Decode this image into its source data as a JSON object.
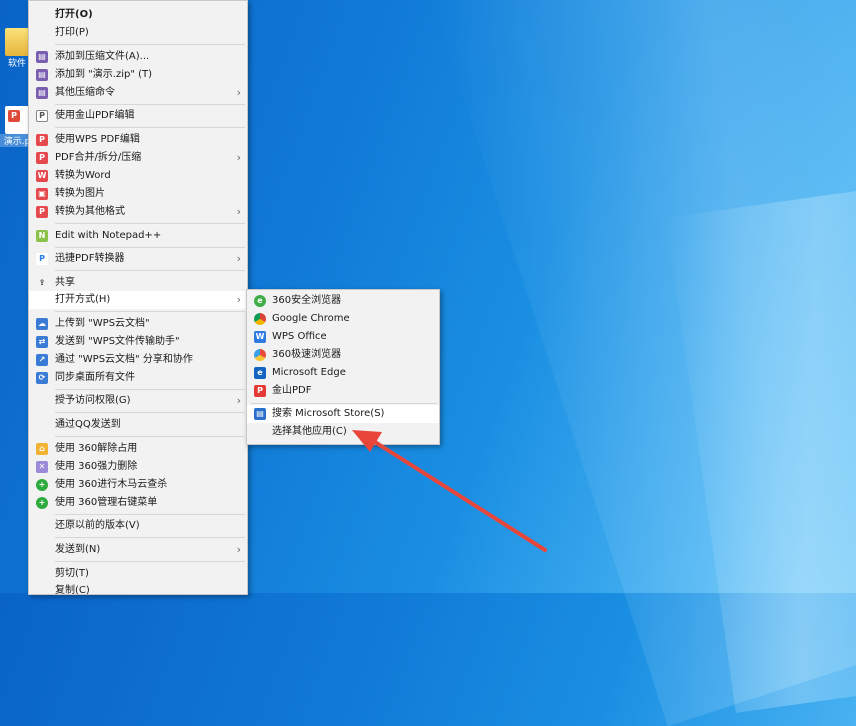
{
  "desktop": {
    "icons": [
      {
        "label": "软件"
      },
      {
        "label": "演示.p"
      }
    ]
  },
  "context_menu": {
    "items": [
      {
        "label": "打开(O)",
        "bold": true
      },
      {
        "label": "打印(P)"
      },
      {
        "label": "添加到压缩文件(A)..."
      },
      {
        "label": "添加到 \"演示.zip\" (T)"
      },
      {
        "label": "其他压缩命令"
      },
      {
        "label": "使用金山PDF编辑"
      },
      {
        "label": "使用WPS PDF编辑"
      },
      {
        "label": "PDF合并/拆分/压缩"
      },
      {
        "label": "转换为Word"
      },
      {
        "label": "转换为图片"
      },
      {
        "label": "转换为其他格式"
      },
      {
        "label": "Edit with Notepad++"
      },
      {
        "label": "迅捷PDF转换器"
      },
      {
        "label": "共享"
      },
      {
        "label": "打开方式(H)"
      },
      {
        "label": "上传到 \"WPS云文档\""
      },
      {
        "label": "发送到 \"WPS文件传输助手\""
      },
      {
        "label": "通过 \"WPS云文档\" 分享和协作"
      },
      {
        "label": "同步桌面所有文件"
      },
      {
        "label": "授予访问权限(G)"
      },
      {
        "label": "通过QQ发送到"
      },
      {
        "label": "使用 360解除占用"
      },
      {
        "label": "使用 360强力删除"
      },
      {
        "label": "使用 360进行木马云查杀"
      },
      {
        "label": "使用 360管理右键菜单"
      },
      {
        "label": "还原以前的版本(V)"
      },
      {
        "label": "发送到(N)"
      },
      {
        "label": "剪切(T)"
      },
      {
        "label": "复制(C)"
      }
    ]
  },
  "open_with_submenu": {
    "items": [
      {
        "label": "360安全浏览器"
      },
      {
        "label": "Google Chrome"
      },
      {
        "label": "WPS Office"
      },
      {
        "label": "360极速浏览器"
      },
      {
        "label": "Microsoft Edge"
      },
      {
        "label": "金山PDF"
      },
      {
        "label": "搜索 Microsoft Store(S)"
      },
      {
        "label": "选择其他应用(C)"
      }
    ]
  },
  "colors": {
    "annotation_arrow": "#e8463a",
    "menu_bg": "#f2f2f2",
    "desktop_blue": "#1079d6"
  }
}
